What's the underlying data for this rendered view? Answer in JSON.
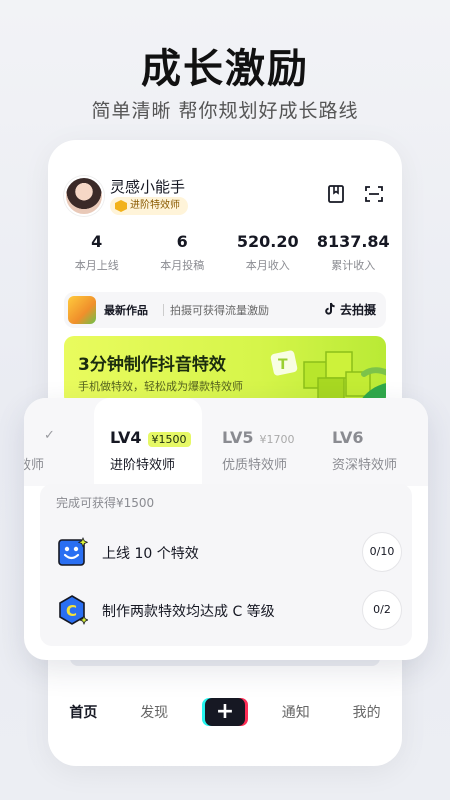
{
  "hero": {
    "title": "成长激励",
    "subtitle": "简单清晰 帮你规划好成长路线"
  },
  "profile": {
    "username": "灵感小能手",
    "level_badge": "进阶特效师",
    "icons": [
      "bookmark-icon",
      "scan-icon"
    ]
  },
  "stats": [
    {
      "value": "4",
      "label": "本月上线"
    },
    {
      "value": "6",
      "label": "本月投稿"
    },
    {
      "value": "520.20",
      "label": "本月收入"
    },
    {
      "value": "8137.84",
      "label": "累计收入"
    }
  ],
  "works_bar": {
    "title": "最新作品",
    "desc": "拍摄可获得流量激励",
    "action": "去拍摄"
  },
  "banner": {
    "title": "3分钟制作抖音特效",
    "subtitle": "手机做特效，轻松成为爆款特效师"
  },
  "nav": {
    "items": [
      "首页",
      "发现",
      "+",
      "通知",
      "我的"
    ],
    "active": "首页"
  },
  "levels": {
    "prev_partial": "效师",
    "tabs": [
      {
        "lv": "LV4",
        "price": "¥1500",
        "name": "进阶特效师"
      },
      {
        "lv": "LV5",
        "price": "¥1700",
        "name": "优质特效师"
      },
      {
        "lv": "LV6",
        "name": "资深特效师"
      }
    ],
    "reward_text": "完成可获得¥1500",
    "tasks": [
      {
        "text": "上线 10 个特效",
        "progress": "0/10"
      },
      {
        "text": "制作两款特效均达成 C 等级",
        "progress": "0/2"
      }
    ]
  },
  "colors": {
    "accent_lime": "#e6f866",
    "brand_cyan": "#25f4ee",
    "brand_red": "#fe2c55",
    "text_primary": "#161823"
  }
}
